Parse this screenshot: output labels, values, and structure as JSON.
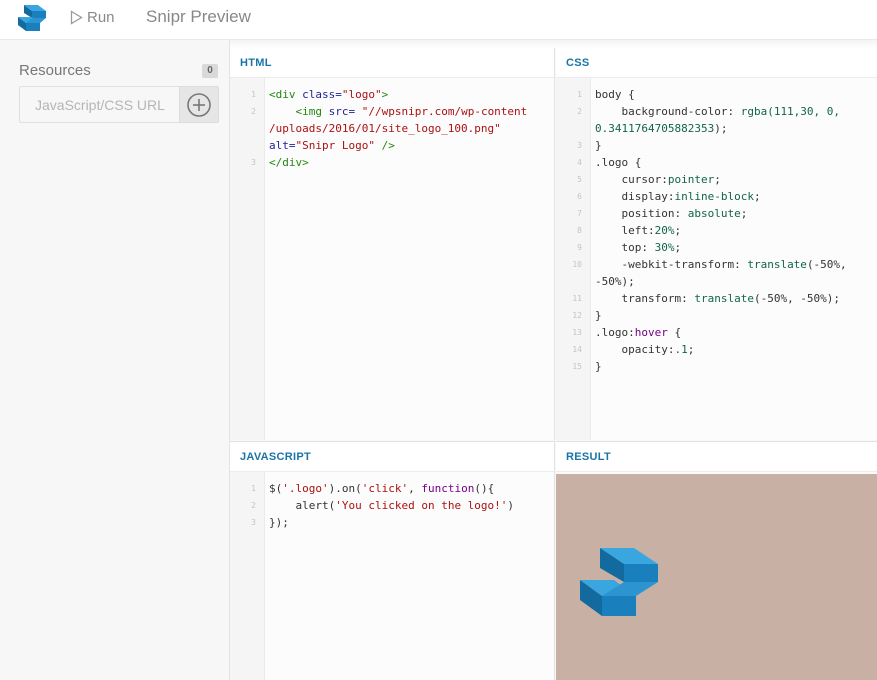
{
  "app": {
    "title": "Snipr Preview",
    "run_label": "Run",
    "brand_color": "#1a8ccc"
  },
  "sidebar": {
    "resources_label": "Resources",
    "resources_count": "0",
    "input_placeholder": "JavaScript/CSS URL",
    "add_icon": "plus-circle-icon"
  },
  "panels": {
    "html": {
      "title": "HTML",
      "line_numbers": [
        "1",
        "2",
        "",
        "",
        "3"
      ],
      "lines": [
        [
          [
            "tg",
            "<div "
          ],
          [
            "at",
            "class="
          ],
          [
            "st",
            "\"logo\""
          ],
          [
            "tg",
            ">"
          ]
        ],
        [
          [
            "tg",
            "    <img "
          ],
          [
            "at",
            "src= "
          ],
          [
            "st",
            "\"//wpsnipr.com/wp-content"
          ]
        ],
        [
          [
            "st",
            "/uploads/2016/01/site_logo_100.png\""
          ]
        ],
        [
          [
            "at",
            "alt="
          ],
          [
            "st",
            "\"Snipr Logo\""
          ],
          [
            "tg",
            " />"
          ]
        ],
        [
          [
            "tg",
            "</div>"
          ]
        ]
      ]
    },
    "css": {
      "title": "CSS",
      "line_numbers": [
        "1",
        "2",
        "",
        "3",
        "4",
        "5",
        "6",
        "7",
        "8",
        "9",
        "10",
        "",
        "11",
        "12",
        "13",
        "14",
        "15"
      ],
      "lines": [
        [
          [
            "sel",
            "body {"
          ]
        ],
        [
          [
            "pr",
            "    background-color: "
          ],
          [
            "vl",
            "rgba(111,30, 0,"
          ]
        ],
        [
          [
            "vl",
            "0.3411764705882353"
          ],
          [
            "pr",
            ");"
          ]
        ],
        [
          [
            "sel",
            "}"
          ]
        ],
        [
          [
            "sel",
            ".logo {"
          ]
        ],
        [
          [
            "pr",
            "    cursor:"
          ],
          [
            "vl",
            "pointer"
          ],
          [
            "pr",
            ";"
          ]
        ],
        [
          [
            "pr",
            "    display:"
          ],
          [
            "vl",
            "inline-block"
          ],
          [
            "pr",
            ";"
          ]
        ],
        [
          [
            "pr",
            "    position: "
          ],
          [
            "vl",
            "absolute"
          ],
          [
            "pr",
            ";"
          ]
        ],
        [
          [
            "pr",
            "    left:"
          ],
          [
            "vl",
            "20%"
          ],
          [
            "pr",
            ";"
          ]
        ],
        [
          [
            "pr",
            "    top: "
          ],
          [
            "vl",
            "30%"
          ],
          [
            "pr",
            ";"
          ]
        ],
        [
          [
            "pr",
            "    -webkit-transform: "
          ],
          [
            "vl",
            "translate"
          ],
          [
            "pr",
            "(-50%,"
          ]
        ],
        [
          [
            "pr",
            "-50%);"
          ]
        ],
        [
          [
            "pr",
            "    transform: "
          ],
          [
            "vl",
            "translate"
          ],
          [
            "pr",
            "(-50%, -50%);"
          ]
        ],
        [
          [
            "sel",
            "}"
          ]
        ],
        [
          [
            "sel",
            ".logo:"
          ],
          [
            "kw",
            "hover"
          ],
          [
            "sel",
            " {"
          ]
        ],
        [
          [
            "pr",
            "    opacity:"
          ],
          [
            "nm",
            ".1"
          ],
          [
            "pr",
            ";"
          ]
        ],
        [
          [
            "sel",
            "}"
          ]
        ]
      ]
    },
    "js": {
      "title": "JAVASCRIPT",
      "line_numbers": [
        "1",
        "2",
        "3"
      ],
      "lines": [
        [
          [
            "pr",
            "$("
          ],
          [
            "st",
            "'.logo'"
          ],
          [
            "pr",
            ").on("
          ],
          [
            "st",
            "'click'"
          ],
          [
            "pr",
            ", "
          ],
          [
            "kw",
            "function"
          ],
          [
            "pr",
            "(){"
          ]
        ],
        [
          [
            "pr",
            "    alert("
          ],
          [
            "st",
            "'You clicked on the logo!'"
          ],
          [
            "pr",
            ")"
          ]
        ],
        [
          [
            "pr",
            "});"
          ]
        ]
      ]
    },
    "result": {
      "title": "RESULT",
      "background": "#c9b0a5"
    }
  }
}
